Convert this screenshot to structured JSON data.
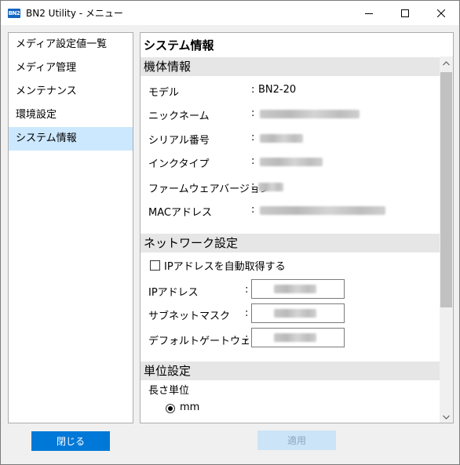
{
  "window": {
    "app_icon_text": "BN2",
    "title": "BN2 Utility - メニュー"
  },
  "sidebar": {
    "items": [
      {
        "label": "メディア設定値一覧",
        "selected": false
      },
      {
        "label": "メディア管理",
        "selected": false
      },
      {
        "label": "メンテナンス",
        "selected": false
      },
      {
        "label": "環境設定",
        "selected": false
      },
      {
        "label": "システム情報",
        "selected": true
      }
    ],
    "close_label": "閉じる"
  },
  "content": {
    "page_title": "システム情報",
    "device_section": {
      "header": "機体情報",
      "rows": [
        {
          "label": "モデル",
          "value": "BN2-20",
          "obscured": false
        },
        {
          "label": "ニックネーム",
          "value": "",
          "obscured": true
        },
        {
          "label": "シリアル番号",
          "value": "",
          "obscured": true
        },
        {
          "label": "インクタイプ",
          "value": "",
          "obscured": true
        },
        {
          "label": "ファームウェアバージョン",
          "value": "",
          "obscured": true
        },
        {
          "label": "MACアドレス",
          "value": "",
          "obscured": true
        }
      ],
      "colon": ":"
    },
    "network_section": {
      "header": "ネットワーク設定",
      "auto_ip_label": "IPアドレスを自動取得する",
      "auto_ip_checked": false,
      "fields": [
        {
          "label": "IPアドレス"
        },
        {
          "label": "サブネットマスク"
        },
        {
          "label": "デフォルトゲートウェイ"
        }
      ],
      "colon": ":"
    },
    "unit_section": {
      "header": "単位設定",
      "length_unit_label": "長さ単位",
      "selected_unit": "mm"
    },
    "apply_label": "適用"
  },
  "colors": {
    "accent": "#0078d7",
    "selected_bg": "#cce8ff",
    "section_bg": "#e6e6e6",
    "disabled_button_bg": "#cce4f7"
  }
}
